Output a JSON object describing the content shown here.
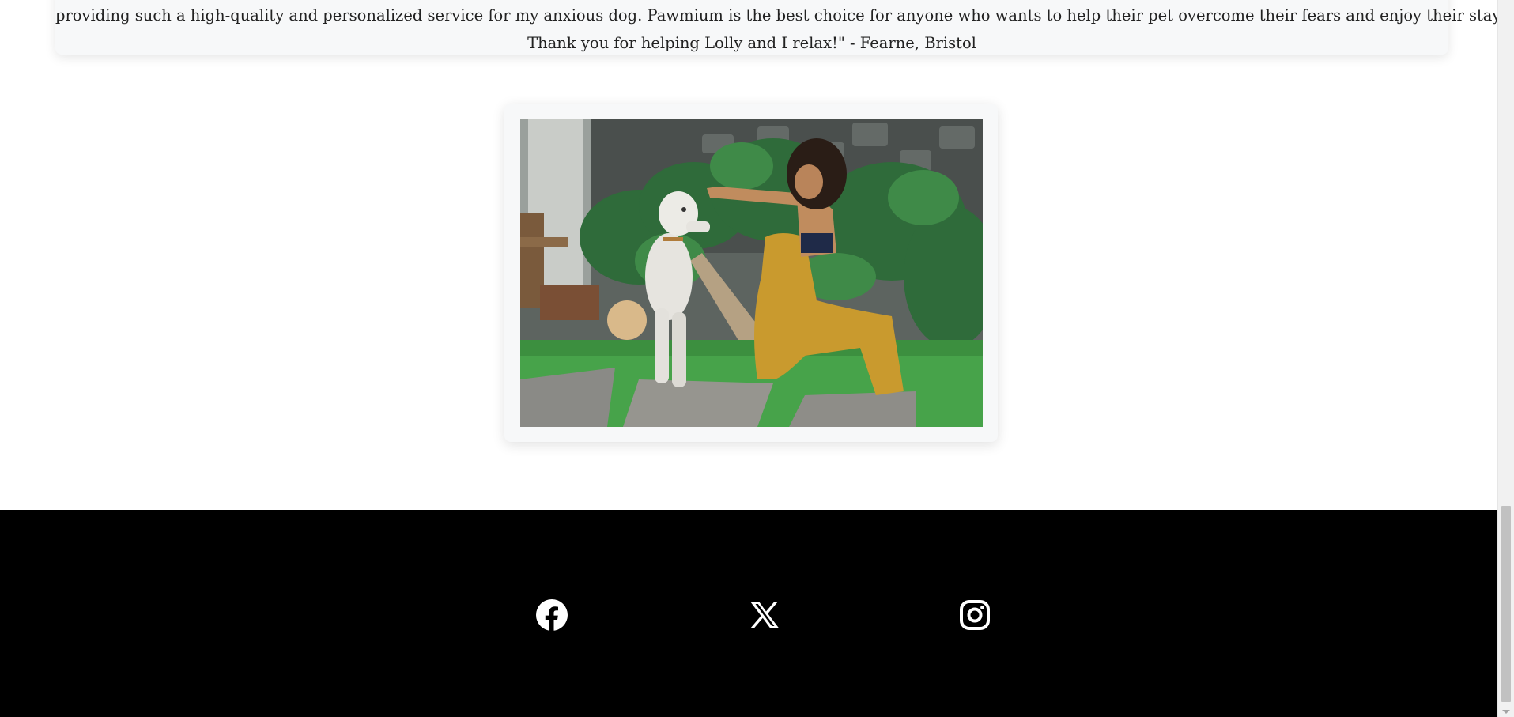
{
  "testimonial": {
    "line1": "providing such a high-quality and personalized service for my anxious dog. Pawmium is the best choice for anyone who wants to help their pet overcome their fears and enjoy their stay.",
    "line2": "Thank you for helping Lolly and I relax!\" - Fearne, Bristol"
  },
  "photo": {
    "icon": "photo-woman-training-white-dog-in-garden"
  },
  "footer": {
    "social": [
      {
        "icon": "facebook-icon"
      },
      {
        "icon": "x-twitter-icon"
      },
      {
        "icon": "instagram-icon"
      }
    ]
  },
  "colors": {
    "footer_bg": "#000000",
    "card_bg": "#f7f8f9",
    "icon_color": "#ffffff"
  }
}
